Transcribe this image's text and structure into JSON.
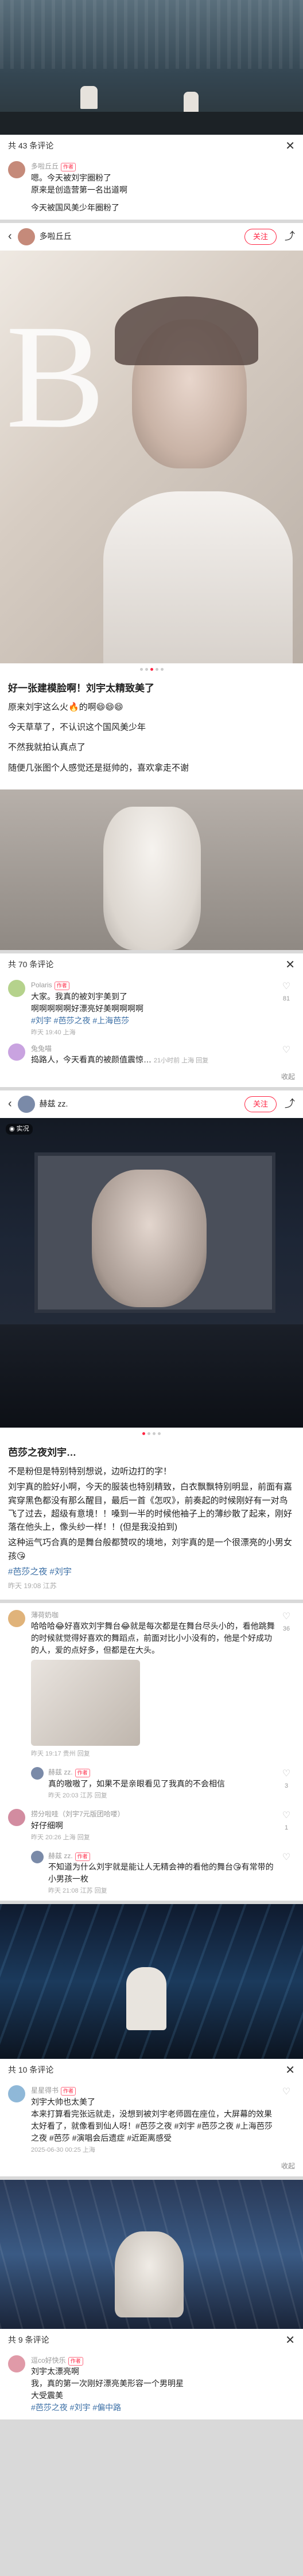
{
  "panel1": {
    "count": "共 43 条评论",
    "c1": {
      "name": "多啦丘丘",
      "tag": "作者",
      "l1": "嗯。今天被刘宇圈粉了",
      "l2": "原来是创造营第一名出道啊",
      "l3": "今天被国风美少年圈粉了"
    }
  },
  "panel2": {
    "author": "多啦丘丘",
    "follow": "关注",
    "title": "好一张建模脸啊！刘宇太精致美了",
    "p1": "原来刘宇这么火🔥的啊😄😄😄",
    "p2": "今天草草了，不认识这个国风美少年",
    "p3": "不然我就拍认真点了",
    "p4": "随便几张图个人感觉还是挺帅的，喜欢拿走不谢",
    "date": "昨天 19:40 上海"
  },
  "panel3": {
    "count": "共 70 条评论",
    "c1": {
      "name": "Polaris",
      "tag": "作者",
      "l1": "大家。我真的被刘宇美到了",
      "l2": "啊啊啊啊啊好漂亮好美啊啊啊啊",
      "tags": "#刘宇 #芭莎之夜 #上海芭莎",
      "meta": "昨天 19:40 上海",
      "likes": "81"
    },
    "c2": {
      "name": "兔兔喵",
      "l1": "捣路人，今天看真的被颜值震惊…",
      "meta": "21小时前 上海 回复"
    },
    "collapse": "收起"
  },
  "panel4": {
    "author": "赫兹 zz.",
    "follow": "关注",
    "live": "实况",
    "title": "芭莎之夜刘宇…",
    "p1": "不是粉但是特别特别想说，边听边打的字！",
    "p2": "刘宇真的脸好小啊，今天的服装也特别精致，白衣飘飘特别明显，前面有嘉宾穿黑色都没有那么醒目，最后一首《怎叹》，前奏起的时候刚好有一对鸟飞了过去，超级有意境！！嗓到一半的时候他袖子上的薄纱散了起来，刚好落在他头上，像头纱一样！！(但是我没拍到)",
    "p3": "这种运气巧合真的是舞台般都赞叹的境地，刘宇真的是一个很漂亮的小男女孩😘",
    "tags": "#芭莎之夜 #刘宇",
    "date": "昨天 19:08 江苏"
  },
  "panel5": {
    "c1": {
      "name": "薄荷奶咖",
      "l1": "哈哈哈😂好喜欢刘宇舞台😂就是每次都是在舞台尽头小的，看他跳舞的时候就觉得好喜欢的舞蹈点，前面对比小小没有的，他是个好成功的人，爱的点好多，但都是在大头。",
      "meta": "昨天 19:17 贵州 回复",
      "likes": "36"
    },
    "c2": {
      "name": "赫兹 zz.",
      "tag": "作者",
      "l1": "真的嗷嗷了，如果不是亲眼看见了我真的不会相信",
      "meta": "昨天 20:03 江苏 回复",
      "likes": "3"
    },
    "c3": {
      "name": "捞分啦哇（刘宇7元版团哈喽）",
      "l1": "好仔细啊",
      "meta": "昨天 20:26 上海 回复",
      "likes": "1"
    },
    "c4": {
      "name": "赫兹 zz.",
      "tag": "作者",
      "l1": "不知道为什么刘宇就是能让人无精会神的看他的舞台😘有常带的小男孩一枚",
      "meta": "昨天 21:08 江苏 回复"
    }
  },
  "panel6": {
    "count": "共 10 条评论",
    "c1": {
      "name": "星星得书",
      "tag": "作者",
      "l1": "刘宇大帅也太美了",
      "l2": "本来打算看完张远就走，没想到被刘宇老师圆在座位，大屏幕的效果太好看了，就像看到仙人呀！#芭莎之夜 #刘宇 #芭莎之夜 #上海芭莎之夜 #芭莎 #演唱会后遗症 #近距离感受",
      "meta": "2025-06-30 00:25 上海"
    },
    "collapse": "收起"
  },
  "panel7": {
    "count": "共 9 条评论",
    "c1": {
      "name": "逗co好快乐",
      "tag": "作者",
      "l1": "刘宇太漂亮啊",
      "l2": "我，真的第一次刚好漂亮美形容一个男明星",
      "l3": "大受震美",
      "tags": "#芭莎之夜 #刘宇 #偏中路"
    }
  }
}
